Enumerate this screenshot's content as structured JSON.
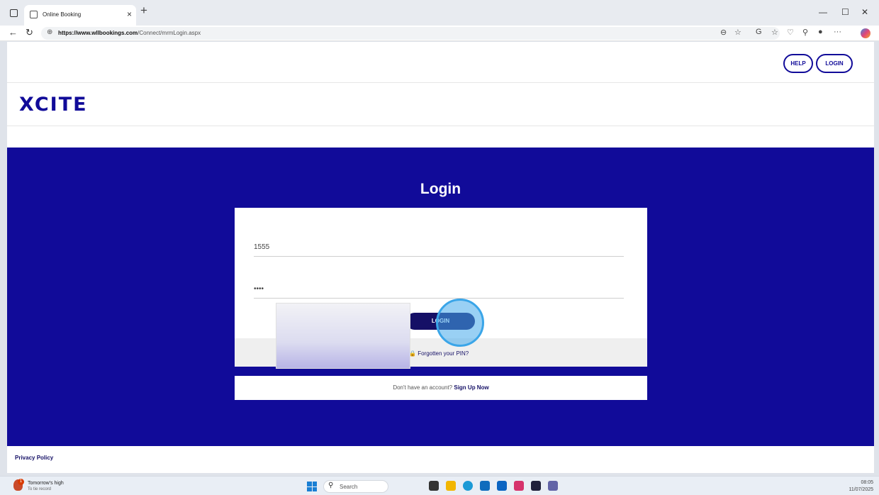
{
  "browser": {
    "tab_title": "Online Booking",
    "url_domain": "https://www.wllbookings.com",
    "url_path": "/Connect/mrmLogin.aspx"
  },
  "header": {
    "help_label": "HELP",
    "login_label": "LOGIN",
    "logo_text": "XCITE"
  },
  "login": {
    "title": "Login",
    "username_value": "1555",
    "pin_value": "••••",
    "login_button": "LOGIN",
    "forgot_link": "Forgotten your PIN?",
    "signup_prefix": "Don't have an account?",
    "signup_link": "Sign Up Now"
  },
  "footer": {
    "privacy": "Privacy Policy"
  },
  "taskbar": {
    "weather_title": "Tomorrow's high",
    "weather_sub": "To tie record",
    "weather_badge": "1",
    "search_placeholder": "Search",
    "time": "08:05",
    "date": "11/07/2025"
  },
  "colors": {
    "brand": "#110b99",
    "button": "#151066"
  }
}
